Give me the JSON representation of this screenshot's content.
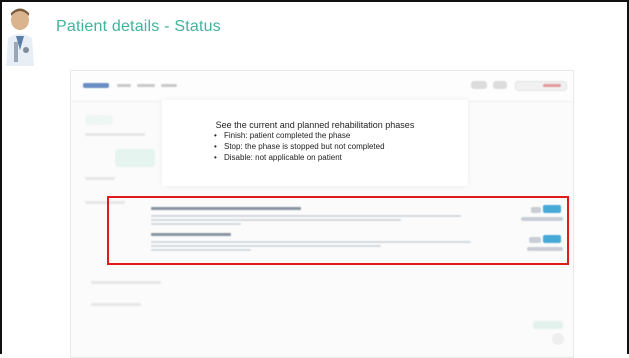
{
  "slide": {
    "title": "Patient details - Status"
  },
  "callout": {
    "heading": "See the current and planned rehabilitation phases",
    "items": [
      "Finish: patient completed the phase",
      "Stop: the phase is stopped but not completed",
      "Disable: not applicable on patient"
    ]
  },
  "colors": {
    "title": "#3fb39d",
    "highlight": "#e01b1b",
    "badge": "#47a9d8"
  },
  "icons": {
    "avatar": "doctor-avatar-icon"
  }
}
